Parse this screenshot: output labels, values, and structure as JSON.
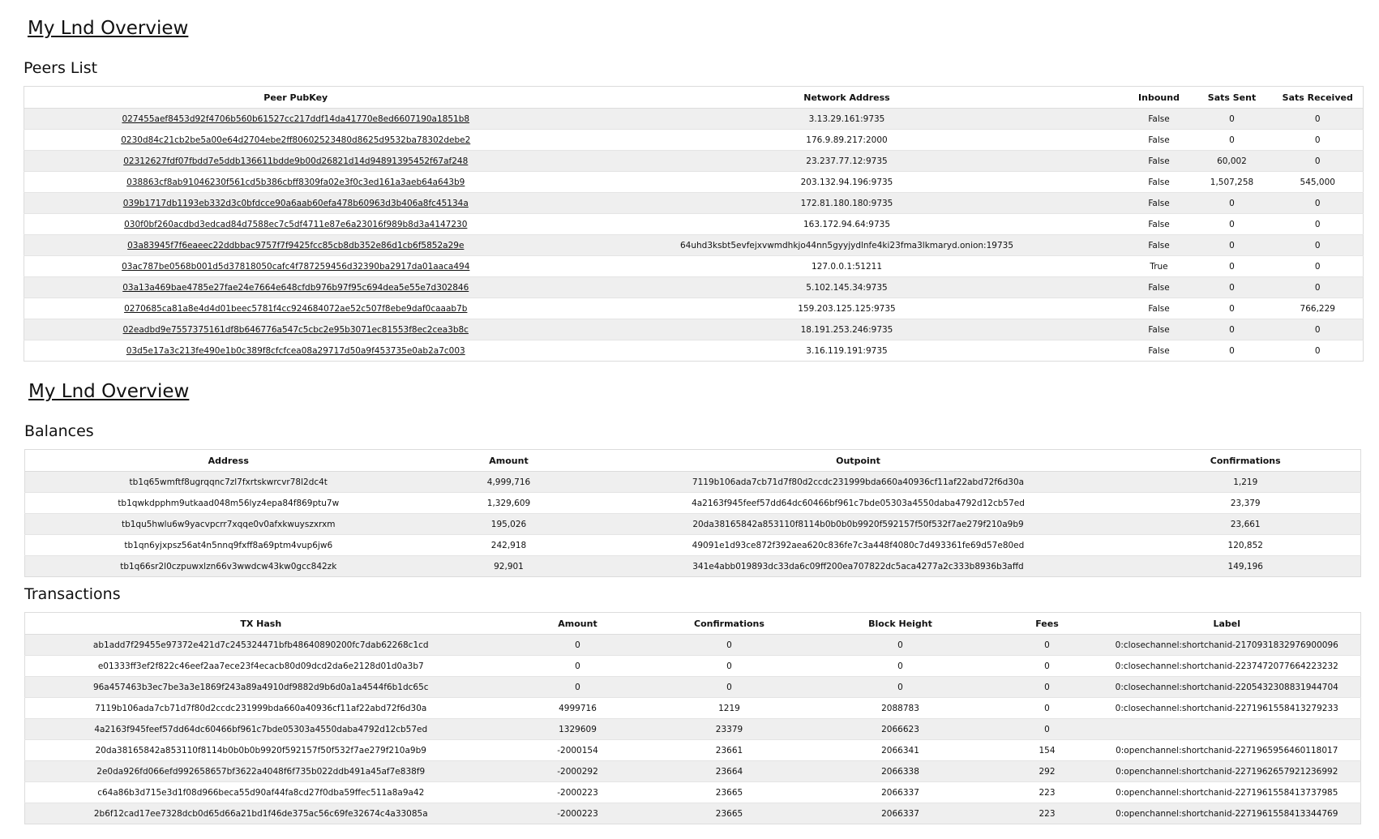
{
  "overview_title_1": "My Lnd Overview",
  "overview_title_2": "My Lnd Overview",
  "peers": {
    "title": "Peers List",
    "headers": [
      "Peer PubKey",
      "Network Address",
      "Inbound",
      "Sats Sent",
      "Sats Received"
    ],
    "rows": [
      [
        "027455aef8453d92f4706b560b61527cc217ddf14da41770e8ed6607190a1851b8",
        "3.13.29.161:9735",
        "False",
        "0",
        "0"
      ],
      [
        "0230d84c21cb2be5a00e64d2704ebe2ff80602523480d8625d9532ba78302debe2",
        "176.9.89.217:2000",
        "False",
        "0",
        "0"
      ],
      [
        "02312627fdf07fbdd7e5ddb136611bdde9b00d26821d14d94891395452f67af248",
        "23.237.77.12:9735",
        "False",
        "60,002",
        "0"
      ],
      [
        "038863cf8ab91046230f561cd5b386cbff8309fa02e3f0c3ed161a3aeb64a643b9",
        "203.132.94.196:9735",
        "False",
        "1,507,258",
        "545,000"
      ],
      [
        "039b1717db1193eb332d3c0bfdcce90a6aab60efa478b60963d3b406a8fc45134a",
        "172.81.180.180:9735",
        "False",
        "0",
        "0"
      ],
      [
        "030f0bf260acdbd3edcad84d7588ec7c5df4711e87e6a23016f989b8d3a4147230",
        "163.172.94.64:9735",
        "False",
        "0",
        "0"
      ],
      [
        "03a83945f7f6eaeec22ddbbac9757f7f9425fcc85cb8db352e86d1cb6f5852a29e",
        "64uhd3ksbt5evfejxvwmdhkjo44nn5gyyjydlnfe4ki23fma3lkmaryd.onion:19735",
        "False",
        "0",
        "0"
      ],
      [
        "03ac787be0568b001d5d37818050cafc4f787259456d32390ba2917da01aaca494",
        "127.0.0.1:51211",
        "True",
        "0",
        "0"
      ],
      [
        "03a13a469bae4785e27fae24e7664e648cfdb976b97f95c694dea5e55e7d302846",
        "5.102.145.34:9735",
        "False",
        "0",
        "0"
      ],
      [
        "0270685ca81a8e4d4d01beec5781f4cc924684072ae52c507f8ebe9daf0caaab7b",
        "159.203.125.125:9735",
        "False",
        "0",
        "766,229"
      ],
      [
        "02eadbd9e7557375161df8b646776a547c5cbc2e95b3071ec81553f8ec2cea3b8c",
        "18.191.253.246:9735",
        "False",
        "0",
        "0"
      ],
      [
        "03d5e17a3c213fe490e1b0c389f8cfcfcea08a29717d50a9f453735e0ab2a7c003",
        "3.16.119.191:9735",
        "False",
        "0",
        "0"
      ]
    ]
  },
  "balances": {
    "title": "Balances",
    "headers": [
      "Address",
      "Amount",
      "Outpoint",
      "Confirmations"
    ],
    "rows": [
      [
        "tb1q65wmftf8ugrqqnc7zl7fxrtskwrcvr78l2dc4t",
        "4,999,716",
        "7119b106ada7cb71d7f80d2ccdc231999bda660a40936cf11af22abd72f6d30a",
        "1,219"
      ],
      [
        "tb1qwkdpphm9utkaad048m56lyz4epa84f869ptu7w",
        "1,329,609",
        "4a2163f945feef57dd64dc60466bf961c7bde05303a4550daba4792d12cb57ed",
        "23,379"
      ],
      [
        "tb1qu5hwlu6w9yacvpcrr7xqqe0v0afxkwuyszxrxm",
        "195,026",
        "20da38165842a853110f8114b0b0b0b9920f592157f50f532f7ae279f210a9b9",
        "23,661"
      ],
      [
        "tb1qn6yjxpsz56at4n5nnq9fxff8a69ptm4vup6jw6",
        "242,918",
        "49091e1d93ce872f392aea620c836fe7c3a448f4080c7d493361fe69d57e80ed",
        "120,852"
      ],
      [
        "tb1q66sr2l0czpuwxlzn66v3wwdcw43kw0gcc842zk",
        "92,901",
        "341e4abb019893dc33da6c09ff200ea707822dc5aca4277a2c333b8936b3affd",
        "149,196"
      ]
    ]
  },
  "transactions": {
    "title": "Transactions",
    "headers": [
      "TX Hash",
      "Amount",
      "Confirmations",
      "Block Height",
      "Fees",
      "Label"
    ],
    "rows": [
      [
        "ab1add7f29455e97372e421d7c245324471bfb48640890200fc7dab62268c1cd",
        "0",
        "0",
        "0",
        "0",
        "0:closechannel:shortchanid-2170931832976900096"
      ],
      [
        "e01333ff3ef2f822c46eef2aa7ece23f4ecacb80d09dcd2da6e2128d01d0a3b7",
        "0",
        "0",
        "0",
        "0",
        "0:closechannel:shortchanid-2237472077664223232"
      ],
      [
        "96a457463b3ec7be3a3e1869f243a89a4910df9882d9b6d0a1a4544f6b1dc65c",
        "0",
        "0",
        "0",
        "0",
        "0:closechannel:shortchanid-2205432308831944704"
      ],
      [
        "7119b106ada7cb71d7f80d2ccdc231999bda660a40936cf11af22abd72f6d30a",
        "4999716",
        "1219",
        "2088783",
        "0",
        "0:closechannel:shortchanid-2271961558413279233"
      ],
      [
        "4a2163f945feef57dd64dc60466bf961c7bde05303a4550daba4792d12cb57ed",
        "1329609",
        "23379",
        "2066623",
        "0",
        ""
      ],
      [
        "20da38165842a853110f8114b0b0b0b9920f592157f50f532f7ae279f210a9b9",
        "-2000154",
        "23661",
        "2066341",
        "154",
        "0:openchannel:shortchanid-2271965956460118017"
      ],
      [
        "2e0da926fd066efd992658657bf3622a4048f6f735b022ddb491a45af7e838f9",
        "-2000292",
        "23664",
        "2066338",
        "292",
        "0:openchannel:shortchanid-2271962657921236992"
      ],
      [
        "c64a86b3d715e3d1f08d966beca55d90af44fa8cd27f0dba59ffec511a8a9a42",
        "-2000223",
        "23665",
        "2066337",
        "223",
        "0:openchannel:shortchanid-2271961558413737985"
      ],
      [
        "2b6f12cad17ee7328dcb0d65d66a21bd1f46de375ac56c69fe32674c4a33085a",
        "-2000223",
        "23665",
        "2066337",
        "223",
        "0:openchannel:shortchanid-2271961558413344769"
      ]
    ]
  }
}
